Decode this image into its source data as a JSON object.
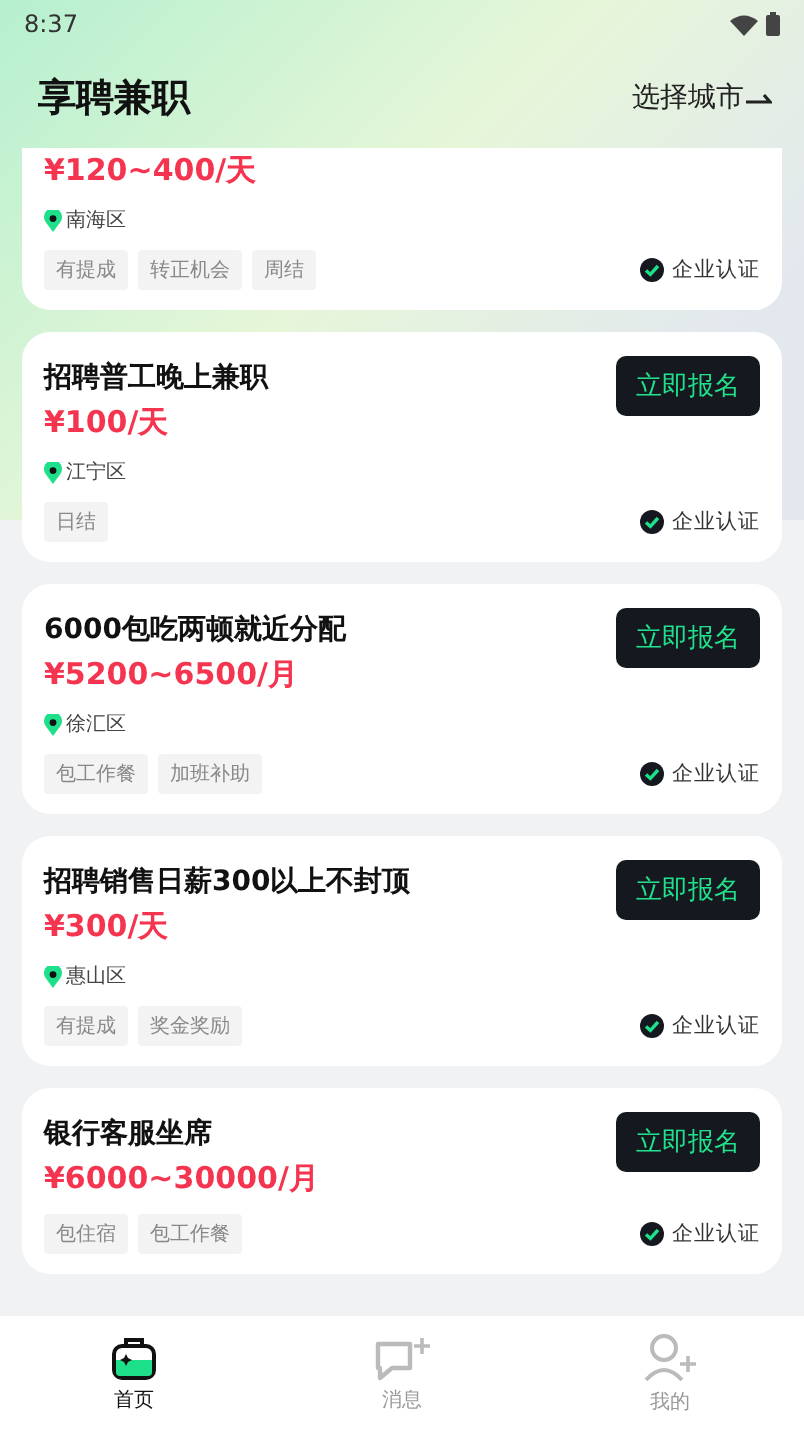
{
  "status_bar": {
    "time": "8:37"
  },
  "header": {
    "title": "享聘兼职",
    "city_button": "选择城市"
  },
  "jobs": [
    {
      "salary": "¥120~400/天",
      "location": "南海区",
      "tags": [
        "有提成",
        "转正机会",
        "周结"
      ],
      "certified": "企业认证"
    },
    {
      "title": "招聘普工晚上兼职",
      "button": "立即报名",
      "salary": "¥100/天",
      "location": "江宁区",
      "tags": [
        "日结"
      ],
      "certified": "企业认证"
    },
    {
      "title": "6000包吃两顿就近分配",
      "button": "立即报名",
      "salary": "¥5200~6500/月",
      "location": "徐汇区",
      "tags": [
        "包工作餐",
        "加班补助"
      ],
      "certified": "企业认证"
    },
    {
      "title": "招聘销售日薪300以上不封顶",
      "button": "立即报名",
      "salary": "¥300/天",
      "location": "惠山区",
      "tags": [
        "有提成",
        "奖金奖励"
      ],
      "certified": "企业认证"
    },
    {
      "title": "银行客服坐席",
      "button": "立即报名",
      "salary": "¥6000~30000/月",
      "tags": [
        "包住宿",
        "包工作餐"
      ],
      "certified": "企业认证"
    }
  ],
  "tab_bar": [
    {
      "kind": "home",
      "label": "首页",
      "selected": true
    },
    {
      "kind": "messages",
      "label": "消息",
      "selected": false
    },
    {
      "kind": "profile",
      "label": "我的",
      "selected": false
    }
  ]
}
